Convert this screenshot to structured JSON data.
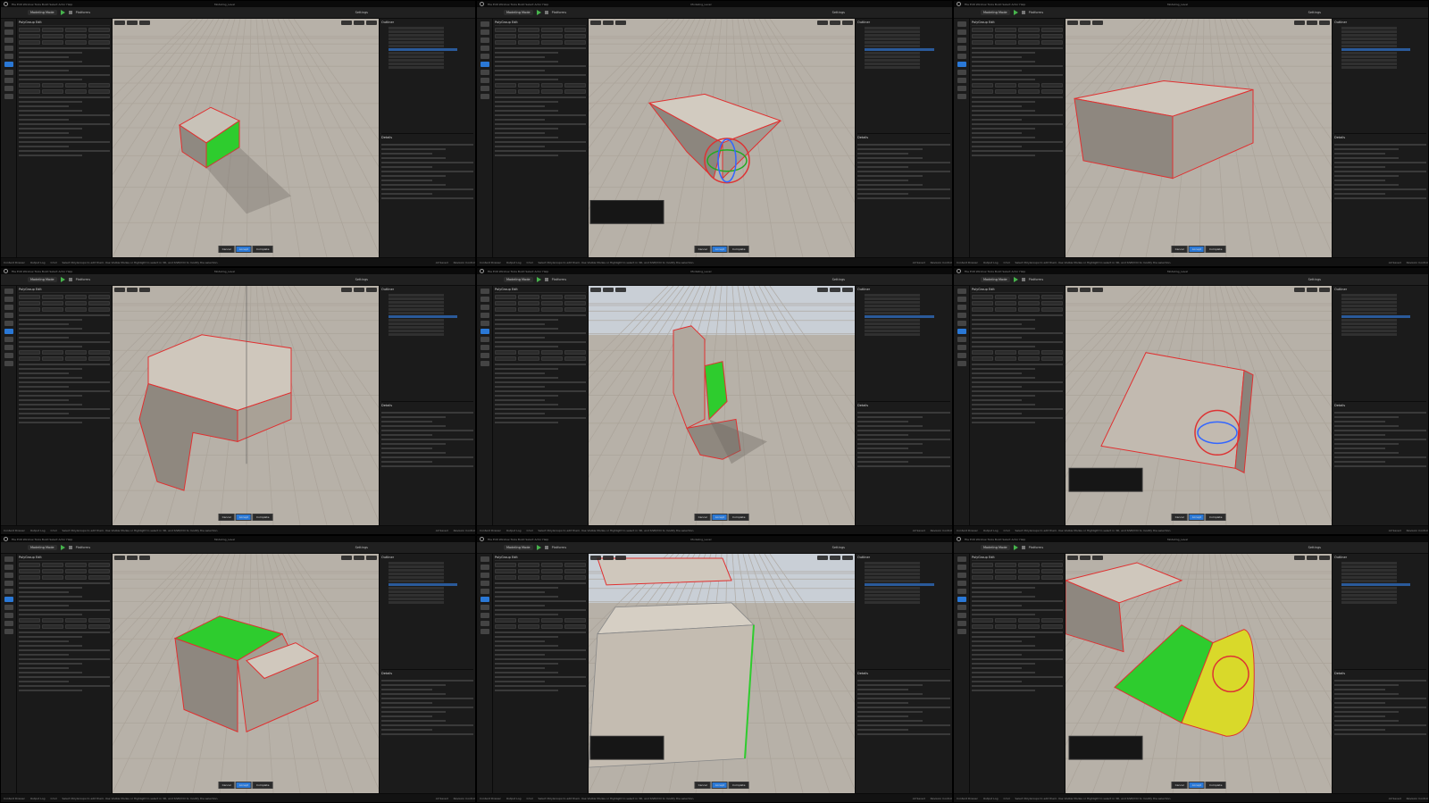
{
  "app": {
    "menu": [
      "File",
      "Edit",
      "Window",
      "Tools",
      "Build",
      "Select",
      "Actor",
      "Help"
    ],
    "project": "Modeling_Level"
  },
  "toolbar": {
    "mode": "Modeling Mode",
    "platforms": "Platforms",
    "settings": "Settings"
  },
  "modeling_panel": {
    "title": "PolyGroup Edit",
    "presets": "Presets"
  },
  "outliner": {
    "title": "Outliner",
    "details": "Details"
  },
  "viewport_buttons": {
    "perspective": "Perspective",
    "lit": "Lit",
    "show": "Show"
  },
  "accept_bar": {
    "cancel": "Cancel",
    "accept": "Accept",
    "complete": "Complete"
  },
  "statusbar": {
    "content_drawer": "Content Drawer",
    "output_log": "Output Log",
    "cmd": "Cmd",
    "message": "Select PolyGroups to edit them. Use Visible Modes or Highlight to select in 3D, and Shift/Ctrl to modify the selection.",
    "all_saved": "All Saved",
    "revision_control": "Revision Control"
  },
  "colors": {
    "editor_bg": "#151515",
    "panel_bg": "#1a1a1a",
    "accent_blue": "#2a78d6",
    "play_green": "#46b34c",
    "selection_green": "#2ecc2e",
    "selection_yellow": "#d9d92a",
    "edge_red": "#e03030",
    "sky": "#c9cfd6",
    "ground": "#b7b1a8"
  },
  "icons": {
    "logo": "unreal-logo-icon",
    "play": "play-icon",
    "stop": "stop-icon",
    "tool": "modeling-tool-icon"
  },
  "panels": [
    {
      "id": "cube",
      "description_visible": false
    },
    {
      "id": "extruded-face",
      "description_visible": false
    },
    {
      "id": "wide-box",
      "description_visible": false
    },
    {
      "id": "l-shape",
      "description_visible": false
    },
    {
      "id": "tall-steps",
      "description_visible": false
    },
    {
      "id": "slab-gizmo",
      "description_visible": false
    },
    {
      "id": "green-top",
      "description_visible": false
    },
    {
      "id": "wall-closeup",
      "description_visible": false
    },
    {
      "id": "bevel-yellow",
      "description_visible": false
    }
  ]
}
